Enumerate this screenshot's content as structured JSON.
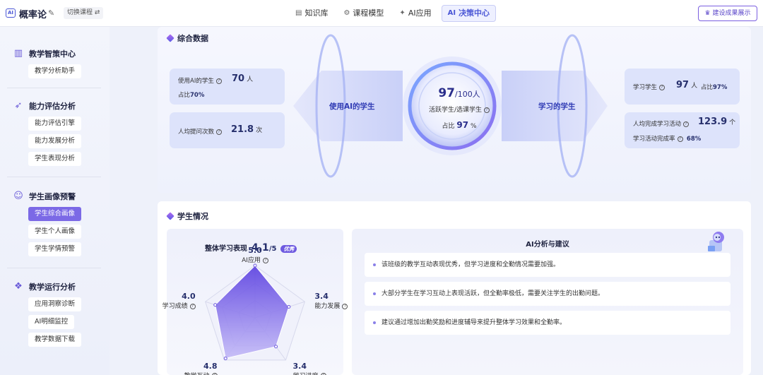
{
  "header": {
    "app_title": "概率论",
    "switch_label": "切换课程 ⇄",
    "nav": [
      {
        "icon": "book-icon",
        "glyph": "▤",
        "label": "知识库"
      },
      {
        "icon": "gear-icon",
        "glyph": "⚙",
        "label": "课程模型"
      },
      {
        "icon": "sparkle-icon",
        "glyph": "✦",
        "label": "AI应用"
      },
      {
        "icon": "ai-badge-icon",
        "glyph": "AI",
        "label": "决策中心"
      }
    ],
    "report_label": "建设成果展示",
    "active_nav": "决策中心"
  },
  "sidebar": {
    "groups": [
      {
        "title": "教学智策中心",
        "icon": "chart-icon",
        "items": [
          "教学分析助手"
        ]
      },
      {
        "title": "能力评估分析",
        "icon": "rocket-icon",
        "items": [
          "能力评估引擎",
          "能力发展分析",
          "学生表现分析"
        ]
      },
      {
        "title": "学生画像预警",
        "icon": "person-icon",
        "items": [
          "学生综合画像",
          "学生个人画像",
          "学生学情预警"
        ]
      },
      {
        "title": "教学运行分析",
        "icon": "cube-icon",
        "items": [
          "应用洞察诊断",
          "AI明细监控",
          "教学数据下载"
        ]
      }
    ],
    "active_item": "学生综合画像"
  },
  "overview": {
    "title": "综合数据",
    "left_cards": [
      {
        "label": "使用AI的学生",
        "value": "70",
        "unit": "人",
        "sub_label": "占比",
        "sub_value": "70%"
      },
      {
        "label": "人均提问次数",
        "value": "21.8",
        "unit": "次"
      }
    ],
    "left_wing": "使用AI的学生",
    "center": {
      "value": "97",
      "total": "/100人",
      "label": "活跃学生/选课学生",
      "ratio_label": "占比",
      "ratio_value": "97",
      "ratio_unit": "%"
    },
    "right_wing": "学习的学生",
    "right_cards": [
      {
        "label": "学习学生",
        "value": "97",
        "unit": "人",
        "sub_label": "占比",
        "sub_value": "97%"
      },
      {
        "label": "人均完成学习活动",
        "value": "123.9",
        "unit": "个",
        "sub_label": "学习活动完成率",
        "sub_value": "68%"
      }
    ]
  },
  "students": {
    "title": "学生情况",
    "radar": {
      "title": "整体学习表现",
      "score": "4.1",
      "max": "/5",
      "badge": "优秀",
      "axes": [
        {
          "label": "AI应用",
          "value": "5.0"
        },
        {
          "label": "能力发展",
          "value": "3.4"
        },
        {
          "label": "学习进度",
          "value": "3.4"
        },
        {
          "label": "教学互动",
          "value": "4.8"
        },
        {
          "label": "学习成绩",
          "value": "4.0"
        }
      ]
    },
    "ai": {
      "title": "AI分析与建议",
      "suggestions": [
        "该班级的教学互动表现优秀，但学习进度和全勤情况需要加强。",
        "大部分学生在学习互动上表现活跃，但全勤率极低，需要关注学生的出勤问题。",
        "建议通过增加出勤奖励和进度辅导来提升整体学习效果和全勤率。"
      ]
    }
  },
  "colors": {
    "accent": "#6e5ae0",
    "primary_text": "#27306d",
    "nav_active": "#4b57d6"
  }
}
